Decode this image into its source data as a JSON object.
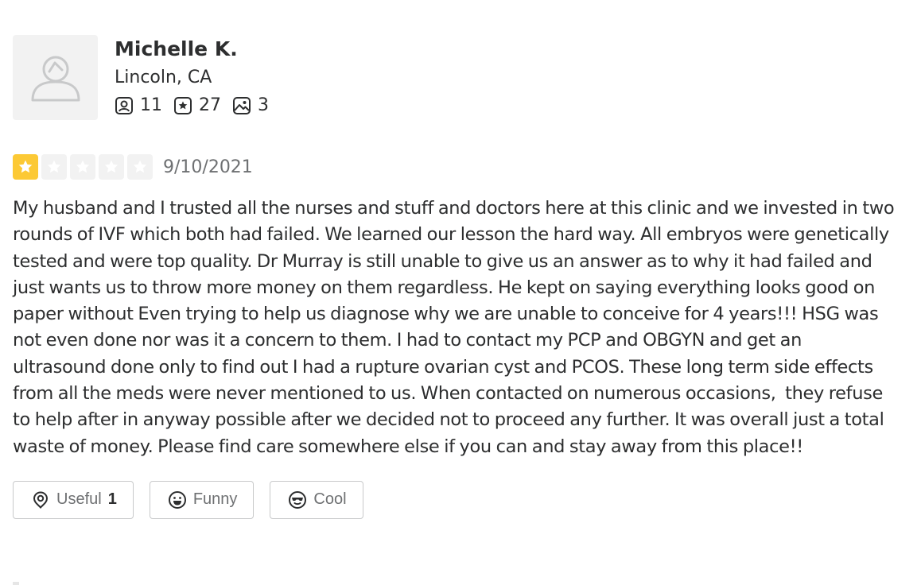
{
  "user": {
    "name": "Michelle K.",
    "location": "Lincoln, CA",
    "friends_count": "11",
    "reviews_count": "27",
    "photos_count": "3",
    "avatar_icon": "default-user-icon"
  },
  "review": {
    "rating": 1,
    "max_rating": 5,
    "star_color": "#fcc935",
    "date": "9/10/2021",
    "text": "My husband and I trusted all the nurses and stuff and doctors here at this clinic and we invested in two rounds of IVF which both had failed. We learned our lesson the hard way. All embryos were genetically tested and were top quality. Dr Murray is still unable to give us an answer as to why it had failed and just wants us to throw more money on them regardless. He kept on saying everything looks good on paper without Even trying to help us diagnose why we are unable to conceive for 4 years!!! HSG was not even done nor was it a concern to them. I had to contact my PCP and OBGYN and get an ultrasound done only to find out I had a rupture ovarian cyst and PCOS. These long term side effects from all the meds were never mentioned to us. When contacted on numerous occasions,  they refuse to help after in anyway possible after we decided not to proceed any further. It was overall just a total waste of money. Please find care somewhere else if you can and stay away from this place!!"
  },
  "reactions": {
    "useful_label": "Useful",
    "useful_count": "1",
    "funny_label": "Funny",
    "cool_label": "Cool"
  }
}
